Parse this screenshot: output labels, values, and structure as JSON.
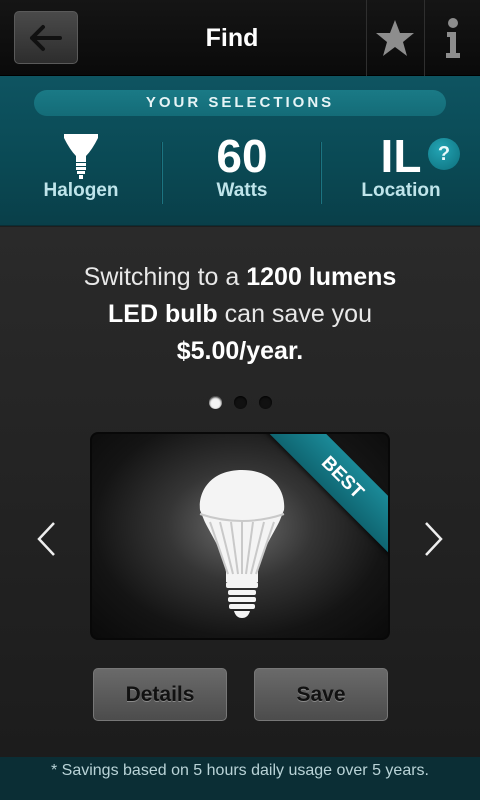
{
  "header": {
    "title": "Find",
    "back_icon": "arrow-left-icon",
    "star_icon": "star-icon",
    "info_icon": "info-icon"
  },
  "selections": {
    "heading": "YOUR SELECTIONS",
    "bulb_type": {
      "icon": "halogen-bulb-icon",
      "label": "Halogen"
    },
    "wattage": {
      "value": "60",
      "label": "Watts"
    },
    "location": {
      "value": "IL",
      "label": "Location"
    },
    "help_label": "?"
  },
  "savings": {
    "line_prefix": "Switching to a ",
    "lumens": "1200 lumens",
    "bulb": "LED bulb",
    "middle": " can save you ",
    "amount": "$5.00/year."
  },
  "carousel": {
    "page_count": 3,
    "active_index": 0,
    "badge": "BEST",
    "image_icon": "led-bulb-icon",
    "prev_icon": "chevron-left-icon",
    "next_icon": "chevron-right-icon"
  },
  "actions": {
    "details_label": "Details",
    "save_label": "Save"
  },
  "footer": {
    "note": "* Savings based on  5 hours daily usage over 5 years."
  },
  "colors": {
    "accent": "#0e5461",
    "ribbon": "#147885",
    "footer": "#0b2e35"
  }
}
